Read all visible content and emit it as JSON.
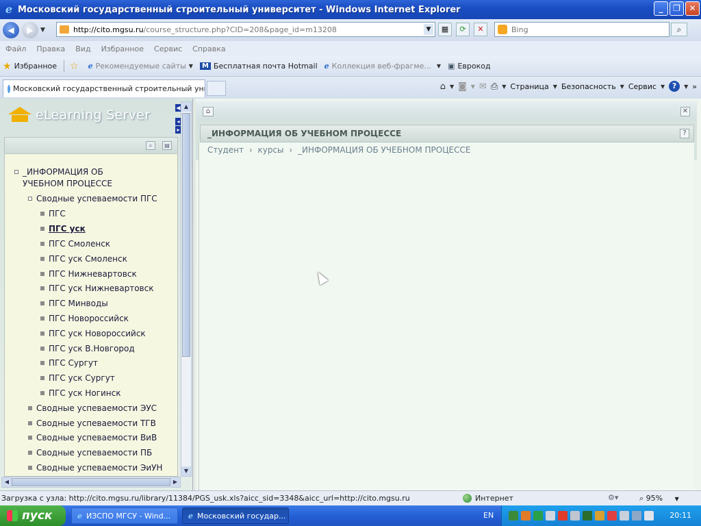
{
  "window": {
    "title": "Московский государственный строительный университет - Windows Internet Explorer"
  },
  "address": {
    "url_host": "http://cito.mgsu.ru",
    "url_path": "/course_structure.php?CID=208&page_id=m13208",
    "search_placeholder": "Bing"
  },
  "menu": [
    "Файл",
    "Правка",
    "Вид",
    "Избранное",
    "Сервис",
    "Справка"
  ],
  "favorites": {
    "label": "Избранное",
    "items": [
      {
        "label": "Рекомендуемые сайты",
        "dropdown": true
      },
      {
        "label": "Бесплатная почта Hotmail",
        "dropdown": false
      },
      {
        "label": "Коллекция веб-фрагме...",
        "dropdown": true
      },
      {
        "label": "Еврокод",
        "dropdown": false
      }
    ]
  },
  "tab": {
    "active_title": "Московский государственный строительный унив..."
  },
  "commandbar": {
    "page": "Страница",
    "safety": "Безопасность",
    "tools": "Сервис"
  },
  "app": {
    "logo_text": "eLearning Server"
  },
  "tree": {
    "root": "_ИНФОРМАЦИЯ ОБ УЧЕБНОМ ПРОЦЕССЕ",
    "group_open": "Сводные успеваемости ПГС",
    "children": [
      "ПГС",
      "ПГС уск",
      "ПГС Смоленск",
      "ПГС уск Смоленск",
      "ПГС Нижневартовск",
      "ПГС уск Нижневартовск",
      "ПГС Минводы",
      "ПГС Новороссийск",
      "ПГС уск Новороссийск",
      "ПГС уск В.Новгород",
      "ПГС Сургут",
      "ПГС уск Сургут",
      "ПГС уск Ногинск"
    ],
    "active_child": "ПГС уск",
    "groups": [
      "Сводные успеваемости ЭУС",
      "Сводные успеваемости ТГВ",
      "Сводные успеваемости ВиВ",
      "Сводные успеваемости ПБ",
      "Сводные успеваемости ЭиУН"
    ]
  },
  "main": {
    "header_title": "_ИНФОРМАЦИЯ ОБ УЧЕБНОМ ПРОЦЕССЕ",
    "breadcrumb": [
      "Студент",
      "курсы",
      "_ИНФОРМАЦИЯ ОБ УЧЕБНОМ ПРОЦЕССЕ"
    ],
    "breadcrumb_sep": "›"
  },
  "status": {
    "text": "Загрузка с узла: http://cito.mgsu.ru/library/11384/PGS_usk.xls?aicc_sid=3348&aicc_url=http://cito.mgsu.ru",
    "zone": "Интернет",
    "zoom": "95%"
  },
  "taskbar": {
    "start": "пуск",
    "items": [
      "ИЗСПО МГСУ - Wind...",
      "Московский государ..."
    ],
    "lang": "EN",
    "clock": "20:11"
  }
}
